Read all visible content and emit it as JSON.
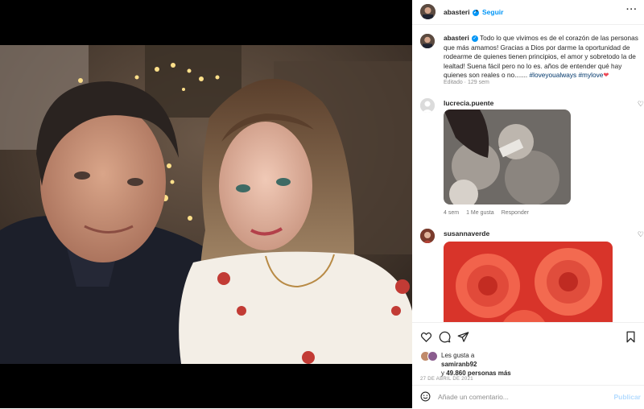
{
  "post": {
    "username": "abasteri",
    "follow_label": "Seguir",
    "more_label": "···"
  },
  "caption": {
    "username": "abasteri",
    "text": "Todo lo que vivimos es de el corazón de las personas que más amamos! Gracias a Dios por darme la oportunidad de rodearme de quienes tienen principios, el amor y sobretodo la de lealtad! Suena fácil pero no lo es. años de entender qué hay quienes son reales o no....... ",
    "hashtags": [
      "#loveyoualways",
      "#mylove"
    ],
    "edited": "Editado · 129 sem"
  },
  "comments": [
    {
      "username": "lucrecia.puente",
      "time": "4 sem",
      "likes": "1 Me gusta",
      "reply": "Responder"
    },
    {
      "username": "susannaverde"
    }
  ],
  "likes": {
    "prefix": "Les gusta a",
    "user": "samiranb92",
    "conj": "y",
    "count": "49.860 personas más"
  },
  "date": "27 DE ABRIL DE 2021",
  "add_comment": {
    "placeholder": "Añade un comentario...",
    "publish": "Publicar"
  },
  "icons": [
    "heart-icon",
    "comment-icon",
    "share-icon",
    "bookmark-icon",
    "emoji-icon",
    "verified-icon"
  ],
  "colors": {
    "link": "#0095f6",
    "hashtag": "#00376b",
    "muted": "#8e8e8e",
    "heart": "#ed4956"
  }
}
